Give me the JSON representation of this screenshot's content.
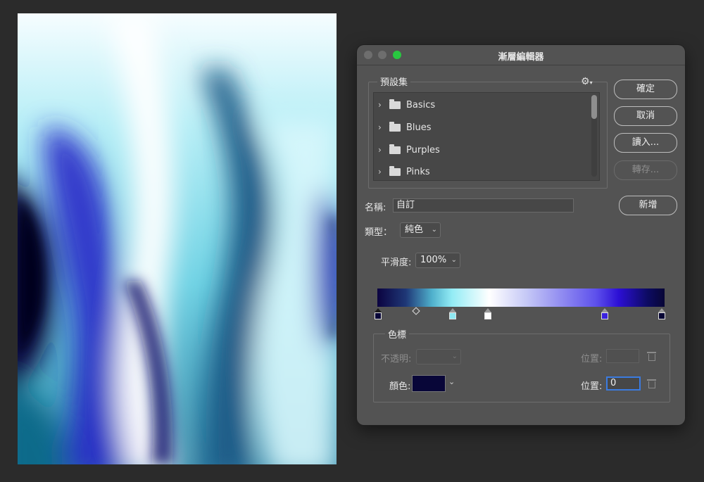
{
  "dialog": {
    "title": "漸層編輯器",
    "presets": {
      "legend": "預設集",
      "gear_icon": "gear-icon",
      "items": [
        {
          "label": "Basics"
        },
        {
          "label": "Blues"
        },
        {
          "label": "Purples"
        },
        {
          "label": "Pinks"
        }
      ]
    },
    "buttons": {
      "ok": "確定",
      "cancel": "取消",
      "load": "讀入...",
      "export": "轉存...",
      "new": "新增"
    },
    "name_label": "名稱:",
    "name_value": "自訂",
    "type_label": "類型：",
    "type_value": "純色",
    "smoothness_label": "平滑度:",
    "smoothness_value": "100%",
    "stops": {
      "legend": "色標",
      "opacity_label": "不透明:",
      "opacity_value": "",
      "opacity_location_label": "位置:",
      "opacity_location_value": "",
      "color_label": "顏色:",
      "color_value": "#080638",
      "color_location_label": "位置:",
      "color_location_value": "0"
    }
  },
  "gradient": {
    "color_stops": [
      {
        "color": "#080638",
        "location": 0
      },
      {
        "color": "#8fe9f2",
        "location": 26
      },
      {
        "color": "#ffffff",
        "location": 39
      },
      {
        "color": "#3a22de",
        "location": 80
      },
      {
        "color": "#080635",
        "location": 100
      }
    ],
    "midpoint_location": 13
  }
}
